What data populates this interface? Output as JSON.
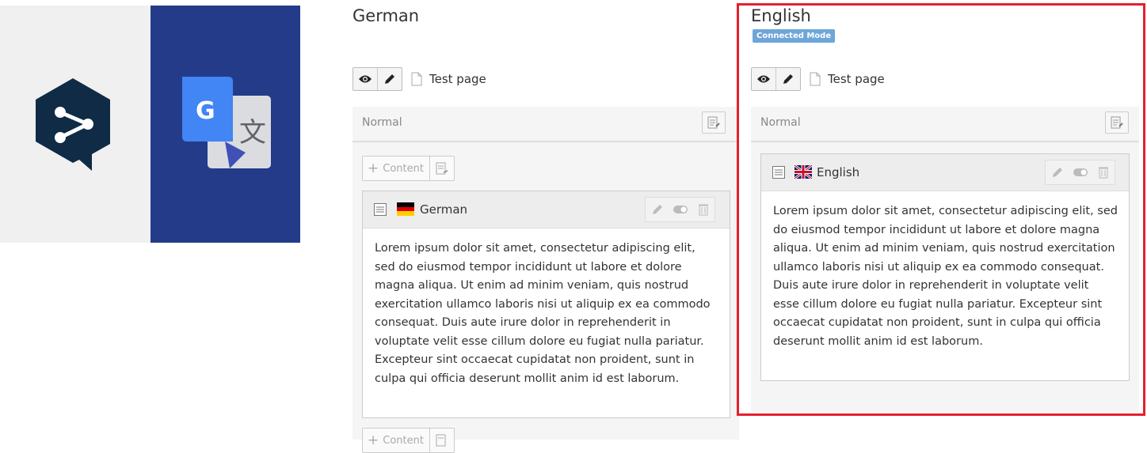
{
  "german": {
    "column_title": "German",
    "page_title": "Test page",
    "section_label": "Normal",
    "content_button_label": "Content",
    "content_button_bottom_label": "Content",
    "element": {
      "title": "German",
      "flag": "flag-germany-icon",
      "body": "Lorem ipsum dolor sit amet, consectetur adipiscing elit, sed do eiusmod tempor incididunt ut labore et dolore magna aliqua. Ut enim ad minim veniam, quis nostrud exercitation ullamco laboris nisi ut aliquip ex ea commodo consequat. Duis aute irure dolor in reprehenderit in voluptate velit esse cillum dolore eu fugiat nulla pariatur. Excepteur sint occaecat cupidatat non proident, sunt in culpa qui officia deserunt mollit anim id est laborum."
    }
  },
  "english": {
    "column_title": "English",
    "badge": "Connected Mode",
    "page_title": "Test page",
    "section_label": "Normal",
    "element": {
      "title": "English",
      "flag": "flag-uk-icon",
      "body": "Lorem ipsum dolor sit amet, consectetur adipiscing elit, sed do eiusmod tempor incididunt ut labore et dolore magna aliqua. Ut enim ad minim veniam, quis nostrud exercitation ullamco laboris nisi ut aliquip ex ea commodo consequat. Duis aute irure dolor in reprehenderit in voluptate velit esse cillum dolore eu fugiat nulla pariatur. Excepteur sint occaecat cupidatat non proident, sunt in culpa qui officia deserunt mollit anim id est laborum."
    }
  },
  "logos": {
    "deepl": "deepl-logo",
    "google_translate": "google-translate-logo",
    "google_letter": "G",
    "translate_glyph": "文"
  },
  "colors": {
    "highlight_border": "#e5202e",
    "badge_bg": "#6ea6d8",
    "google_panel_bg": "#243b8a",
    "deepl_bg": "#f0f0f0",
    "deepl_mark": "#0f2b46"
  }
}
